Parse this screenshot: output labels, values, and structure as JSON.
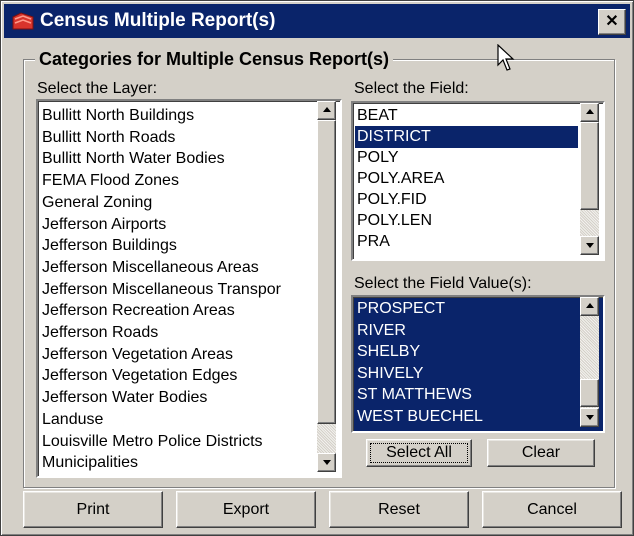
{
  "window": {
    "title": "Census Multiple Report(s)",
    "close_glyph": "✕"
  },
  "group": {
    "title": "Categories for Multiple Census Report(s)"
  },
  "layer": {
    "label": "Select the Layer:",
    "items": [
      "Bullitt North Buildings",
      "Bullitt North Roads",
      "Bullitt North Water Bodies",
      "FEMA Flood Zones",
      "General Zoning",
      "Jefferson Airports",
      "Jefferson Buildings",
      "Jefferson Miscellaneous Areas",
      "Jefferson Miscellaneous Transpor",
      "Jefferson Recreation Areas",
      "Jefferson Roads",
      "Jefferson Vegetation Areas",
      "Jefferson Vegetation Edges",
      "Jefferson Water Bodies",
      "Landuse",
      "Louisville Metro Police Districts",
      "Municipalities"
    ]
  },
  "field": {
    "label": "Select the Field:",
    "items": [
      "BEAT",
      "DISTRICT",
      "POLY",
      "POLY.AREA",
      "POLY.FID",
      "POLY.LEN",
      "PRA"
    ],
    "selected": "DISTRICT"
  },
  "value": {
    "label": "Select the Field Value(s):",
    "items": [
      "PROSPECT",
      "RIVER",
      "SHELBY",
      "SHIVELY",
      "ST MATTHEWS",
      "WEST BUECHEL"
    ]
  },
  "buttons": {
    "select_all": "Select All",
    "clear": "Clear",
    "print": "Print",
    "export": "Export",
    "reset": "Reset",
    "cancel": "Cancel"
  },
  "colors": {
    "titlebar": "#0a246a",
    "selection": "#0a246a",
    "face": "#d4d0c8"
  },
  "icons": {
    "app": "report-icon",
    "close": "close-icon",
    "cursor": "mouse-pointer-icon"
  }
}
